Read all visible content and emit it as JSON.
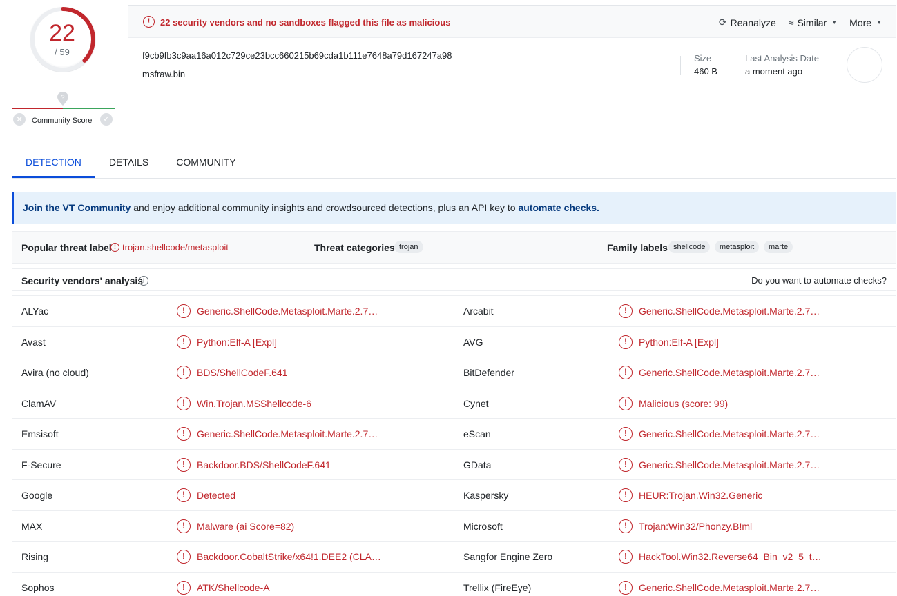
{
  "score": {
    "detections": "22",
    "total": "/ 59",
    "fraction": 0.373
  },
  "community": {
    "label": "Community Score",
    "x_glyph": "✕",
    "check_glyph": "✓",
    "marker_icon": "question-pin-icon"
  },
  "header": {
    "alert_glyph": "!",
    "alert_text": "22 security vendors and no sandboxes flagged this file as malicious",
    "actions": {
      "reanalyze": "Reanalyze",
      "similar": "Similar",
      "more": "More"
    },
    "hash": "f9cb9fb3c9aa16a012c729ce23bcc660215b69cda1b111e7648a79d167247a98",
    "filename": "msfraw.bin",
    "size_label": "Size",
    "size_value": "460 B",
    "date_label": "Last Analysis Date",
    "date_value": "a moment ago"
  },
  "tabs": [
    "DETECTION",
    "DETAILS",
    "COMMUNITY"
  ],
  "banner": {
    "link1": "Join the VT Community",
    "text": " and enjoy additional community insights and crowdsourced detections, plus an API key to ",
    "link2": "automate checks."
  },
  "labels": {
    "popular_label": "Popular threat label",
    "popular_value": "trojan.shellcode/metasploit",
    "categories_label": "Threat categories",
    "categories": [
      "trojan"
    ],
    "family_label": "Family labels",
    "families": [
      "shellcode",
      "metasploit",
      "marte"
    ]
  },
  "vendors_header": {
    "title": "Security vendors' analysis",
    "info_glyph": "i",
    "automate": "Do you want to automate checks?"
  },
  "vendors": [
    {
      "l_name": "ALYac",
      "l_result": "Generic.ShellCode.Metasploit.Marte.2.7…",
      "r_name": "Arcabit",
      "r_result": "Generic.ShellCode.Metasploit.Marte.2.7…"
    },
    {
      "l_name": "Avast",
      "l_result": "Python:Elf-A [Expl]",
      "r_name": "AVG",
      "r_result": "Python:Elf-A [Expl]"
    },
    {
      "l_name": "Avira (no cloud)",
      "l_result": "BDS/ShellCodeF.641",
      "r_name": "BitDefender",
      "r_result": "Generic.ShellCode.Metasploit.Marte.2.7…"
    },
    {
      "l_name": "ClamAV",
      "l_result": "Win.Trojan.MSShellcode-6",
      "r_name": "Cynet",
      "r_result": "Malicious (score: 99)"
    },
    {
      "l_name": "Emsisoft",
      "l_result": "Generic.ShellCode.Metasploit.Marte.2.7…",
      "r_name": "eScan",
      "r_result": "Generic.ShellCode.Metasploit.Marte.2.7…"
    },
    {
      "l_name": "F-Secure",
      "l_result": "Backdoor.BDS/ShellCodeF.641",
      "r_name": "GData",
      "r_result": "Generic.ShellCode.Metasploit.Marte.2.7…"
    },
    {
      "l_name": "Google",
      "l_result": "Detected",
      "r_name": "Kaspersky",
      "r_result": "HEUR:Trojan.Win32.Generic"
    },
    {
      "l_name": "MAX",
      "l_result": "Malware (ai Score=82)",
      "r_name": "Microsoft",
      "r_result": "Trojan:Win32/Phonzy.B!ml"
    },
    {
      "l_name": "Rising",
      "l_result": "Backdoor.CobaltStrike/x64!1.DEE2 (CLA…",
      "r_name": "Sangfor Engine Zero",
      "r_result": "HackTool.Win32.Reverse64_Bin_v2_5_t…"
    },
    {
      "l_name": "Sophos",
      "l_result": "ATK/Shellcode-A",
      "r_name": "Trellix (FireEye)",
      "r_result": "Generic.ShellCode.Metasploit.Marte.2.7…"
    }
  ],
  "colors": {
    "malicious": "#c1272d",
    "accent": "#0b4dda",
    "banner_bg": "#e6f1fb"
  }
}
